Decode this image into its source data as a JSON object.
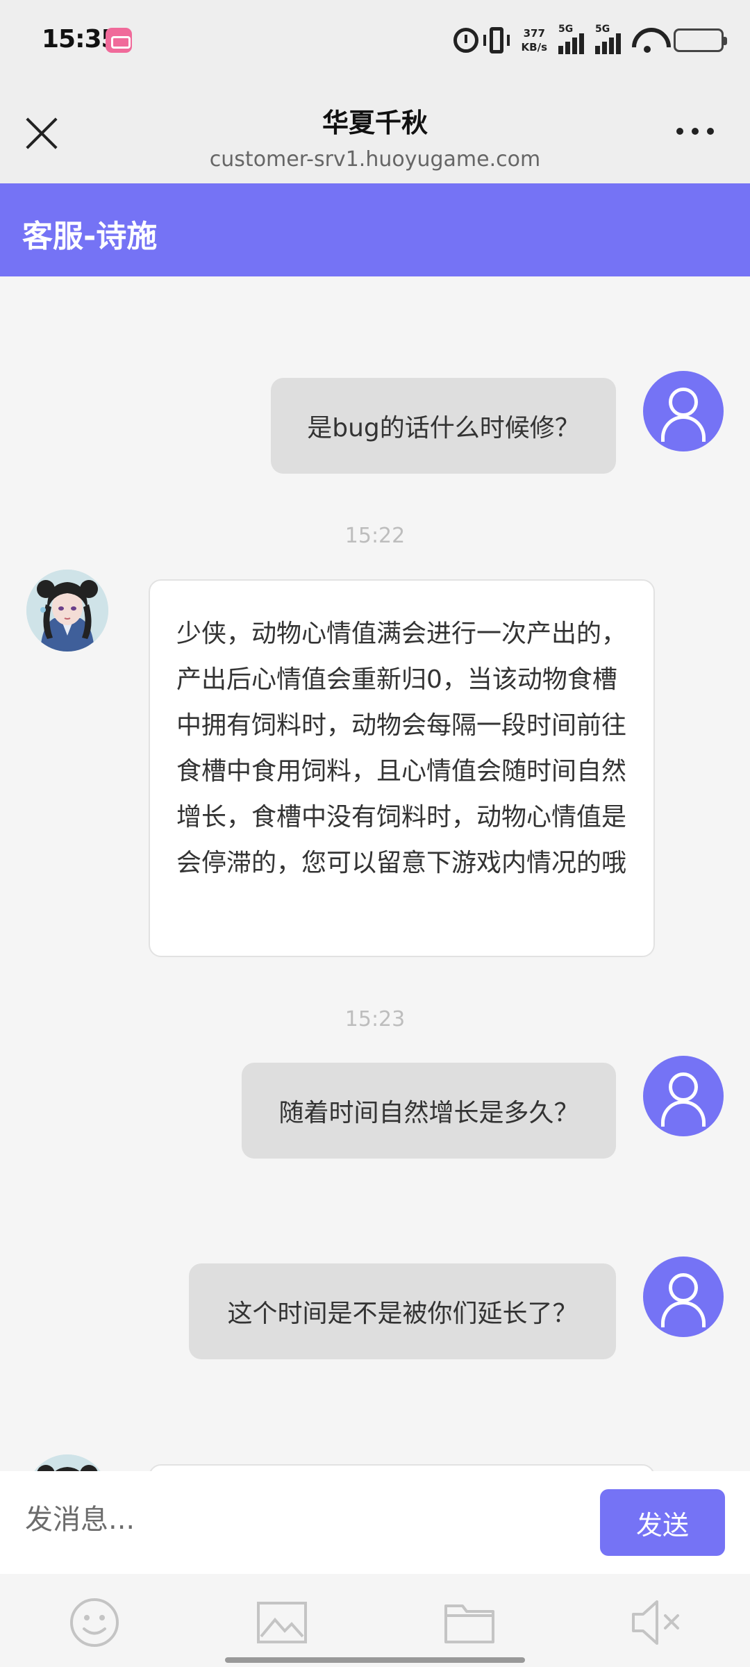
{
  "status_bar": {
    "time": "15:35",
    "net_speed_value": "377",
    "net_speed_unit": "KB/s",
    "sim1_label": "5G",
    "sim2_label": "5G"
  },
  "browser": {
    "title": "华夏千秋",
    "url": "customer-srv1.huoyugame.com"
  },
  "chat": {
    "header_title": "客服-诗施",
    "messages": [
      {
        "from": "user",
        "text": "是bug的话什么时候修？"
      },
      {
        "type": "timestamp",
        "text": "15:22"
      },
      {
        "from": "agent",
        "text": "少侠，动物心情值满会进行一次产出的，产出后心情值会重新归0，当该动物食槽中拥有饲料时，动物会每隔一段时间前往食槽中食用饲料，且心情值会随时间自然增长，食槽中没有饲料时，动物心情值是会停滞的，您可以留意下游戏内情况的哦"
      },
      {
        "type": "timestamp",
        "text": "15:23"
      },
      {
        "from": "user",
        "text": "随着时间自然增长是多久？"
      },
      {
        "from": "user",
        "text": "这个时间是不是被你们延长了？"
      }
    ]
  },
  "input": {
    "placeholder": "发消息...",
    "send_label": "发送"
  },
  "toolbar": {
    "icons": [
      "emoji-icon",
      "image-icon",
      "folder-icon",
      "mute-icon"
    ]
  },
  "colors": {
    "accent": "#7573f5",
    "user_bubble": "#dedede",
    "agent_bubble": "#ffffff",
    "background": "#f5f5f5"
  }
}
